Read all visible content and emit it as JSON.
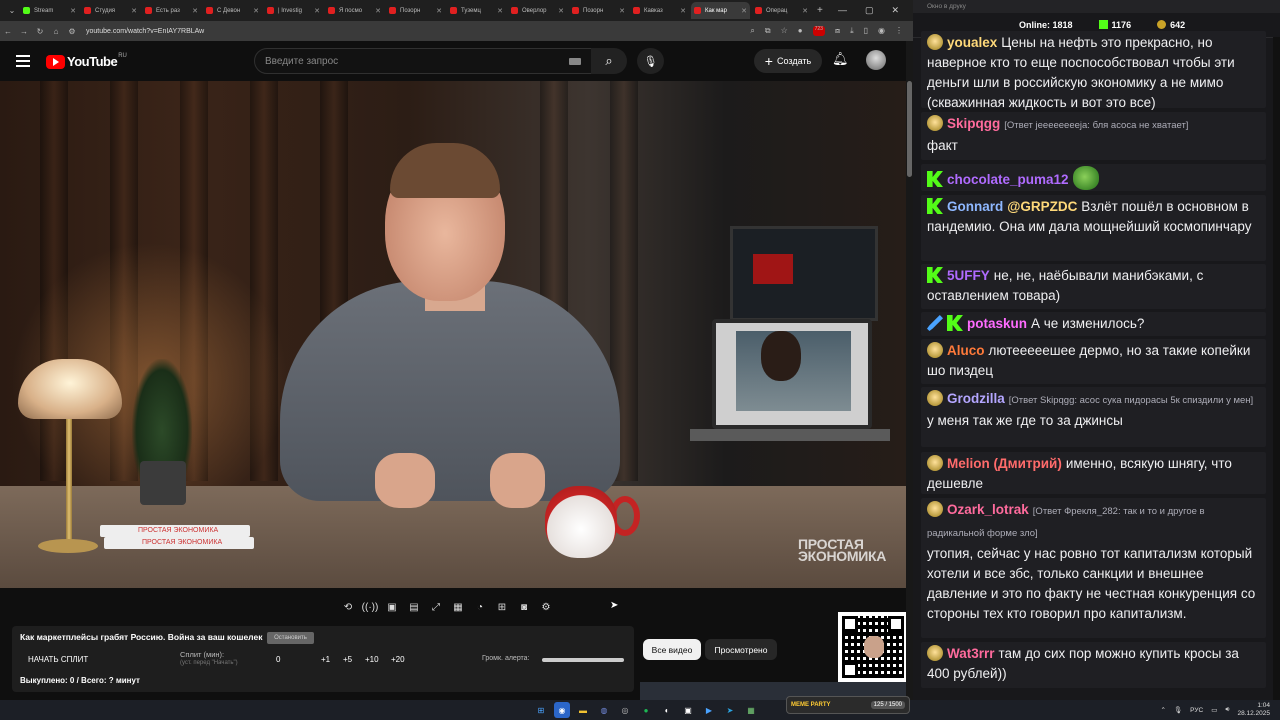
{
  "browser": {
    "tabs": [
      {
        "label": "Stream",
        "active": false,
        "kick": true
      },
      {
        "label": "Студия",
        "active": false
      },
      {
        "label": "Есть раз",
        "active": false
      },
      {
        "label": "С Девон",
        "active": false
      },
      {
        "label": "| Investig",
        "active": false
      },
      {
        "label": "Я посмо",
        "active": false
      },
      {
        "label": "Позорн",
        "active": false
      },
      {
        "label": "Туземц",
        "active": false
      },
      {
        "label": "Оверлор",
        "active": false
      },
      {
        "label": "Позорн",
        "active": false
      },
      {
        "label": "Кавказ",
        "active": false
      },
      {
        "label": "Как мар",
        "active": true
      },
      {
        "label": "Операц",
        "active": false
      }
    ],
    "url": "youtube.com/watch?v=EnIAY7RBLAw",
    "extension_badge": "723"
  },
  "youtube": {
    "logo_text": "YouTube",
    "logo_region": "RU",
    "search_placeholder": "Введите запрос",
    "create_label": "Создать",
    "video_watermark": [
      "ПРОСТАЯ",
      "ЭКОНОМИКА"
    ],
    "book_titles": [
      "ПРОСТАЯ ЭКОНОМИКА",
      "ПРОСТАЯ ЭКОНОМИКА"
    ],
    "chips": [
      "Все видео",
      "Просмотрено"
    ]
  },
  "panel": {
    "title": "Как маркетплейсы грабят Россию. Война за ваш кошелек",
    "stop_label": "Остановить",
    "start_label": "НАЧАТЬ СПЛИТ",
    "split_label": "Сплит (мин):",
    "split_hint": "(уст. перед \"Начать\")",
    "split_value": "0",
    "increments": [
      "+1",
      "+5",
      "+10",
      "+20"
    ],
    "volume_label": "Громк. алерта:",
    "bought_text": "Выкуплено: 0 / Всего: ? минут"
  },
  "chat": {
    "window_title": "Окно в друку",
    "online_label": "Online:",
    "online_count": "1818",
    "kick_count": "1176",
    "coin_count": "642",
    "messages": [
      {
        "user": "youalex",
        "color": "#ffd97a",
        "reply": "",
        "text": "Цены на нефть это прекрасно, но наверное кто то еще поспособствовал чтобы эти деньги шли в российскую экономику а не мимо (скважинная жидкость и вот это все)"
      },
      {
        "user": "Skipqgg",
        "color": "#ff6b9d",
        "reply": "[Ответ jeeeeeeeeja: бля асоса не хватает]",
        "text": "факт"
      },
      {
        "user": "chocolate_puma12",
        "color": "#b06bff",
        "reply": "",
        "text": ""
      },
      {
        "user": "Gonnard",
        "color": "#8fb8ff",
        "reply": "",
        "text": "Взлёт пошёл в основном в пандемию. Она им дала мощнейший космопинчару",
        "mention": "@GRPZDC"
      },
      {
        "user": "5UFFY",
        "color": "#b06bff",
        "reply": "",
        "text": "не, не, наёбывали манибэками, с оставлением товара)"
      },
      {
        "user": "potaskun",
        "color": "#ff6bff",
        "reply": "",
        "text": "А че изменилось?"
      },
      {
        "user": "Aluco",
        "color": "#ff7a3a",
        "reply": "",
        "text": "лютееееешее дермо, но за такие копейки шо пиздец"
      },
      {
        "user": "Grodzilla",
        "color": "#b4a6ff",
        "reply": "[Ответ Skipqgg: асос сука пидорасы 5к спиздили у мен]",
        "text": "у меня так же где то за джинсы"
      },
      {
        "user": "Melion (Дмитрий)",
        "color": "#ff6b6b",
        "reply": "",
        "text": "именно, всякую шнягу, что дешевле"
      },
      {
        "user": "Ozark_lotrak",
        "color": "#ff6b9d",
        "reply": "[Ответ Фрекля_282: так и то и другое в радикальной форме зло]",
        "text": "утопия, сейчас у нас ровно тот капитализм который хотели и все збс, только санкции и внешнее давление и это по факту не честная конкуренция со стороны тех кто говорил про капитализм."
      },
      {
        "user": "Wat3rrr",
        "color": "#ff6b9d",
        "reply": "",
        "text": "там до сих пор можно купить кросы за 400 рублей))"
      }
    ]
  },
  "taskbar": {
    "meme_label": "MEME PARTY",
    "meme_counter": "125 / 1500",
    "lang": "РУС",
    "time": "1:04",
    "date": "28.12.2025"
  }
}
